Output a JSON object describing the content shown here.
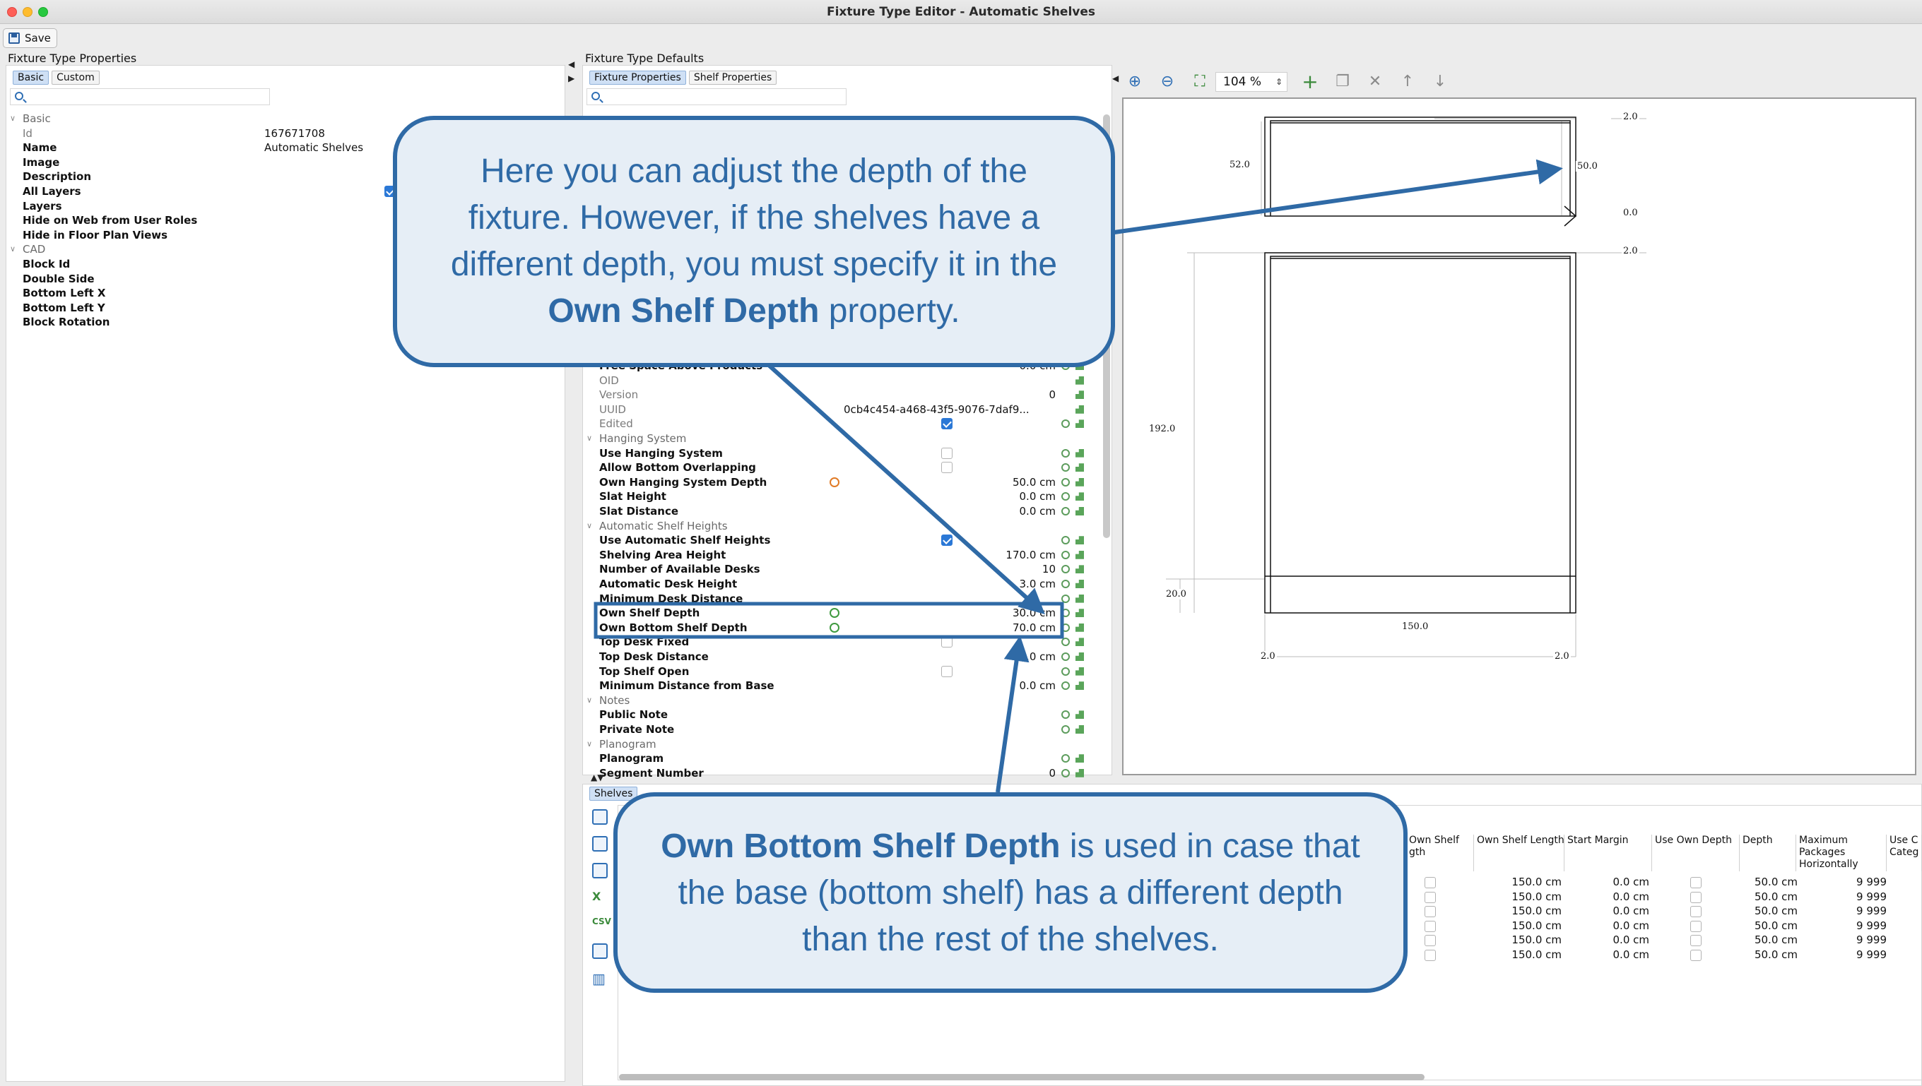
{
  "window": {
    "title": "Fixture Type Editor - Automatic Shelves"
  },
  "toolbar": {
    "save_label": "Save"
  },
  "left": {
    "section_title": "Fixture Type Properties",
    "tabs": [
      "Basic",
      "Custom"
    ],
    "groups": [
      {
        "name": "Basic",
        "rows": [
          {
            "key": "Id",
            "value": "167671708",
            "dim": true
          },
          {
            "key": "Name",
            "value": "Automatic Shelves"
          },
          {
            "key": "Image",
            "value": ""
          },
          {
            "key": "Description",
            "value": ""
          },
          {
            "key": "All Layers",
            "value": "",
            "checked": true
          },
          {
            "key": "Layers",
            "value": ""
          },
          {
            "key": "Hide on Web from User Roles",
            "value": ""
          },
          {
            "key": "Hide in Floor Plan Views",
            "value": ""
          }
        ]
      },
      {
        "name": "CAD",
        "rows": [
          {
            "key": "Block Id",
            "value": ""
          },
          {
            "key": "Double Side",
            "value": ""
          },
          {
            "key": "Bottom Left X",
            "value": ""
          },
          {
            "key": "Bottom Left Y",
            "value": ""
          },
          {
            "key": "Block Rotation",
            "value": ""
          }
        ]
      }
    ]
  },
  "middle": {
    "section_title": "Fixture Type Defaults",
    "tabs": [
      "Fixture Properties",
      "Shelf Properties"
    ],
    "rows": [
      {
        "key": "Free Space Above Products",
        "value": "0.0 cm",
        "partial": true
      },
      {
        "key": "OID",
        "value": "",
        "dim": true
      },
      {
        "key": "Version",
        "value": "0",
        "dim": true
      },
      {
        "key": "UUID",
        "value": "0cb4c454-a468-43f5-9076-7daf9...",
        "dim": true
      },
      {
        "key": "Edited",
        "value": "",
        "dim": true,
        "checked": true
      },
      {
        "key": "Hanging System",
        "group": true
      },
      {
        "key": "Use Hanging System",
        "value": "",
        "checkbox": true
      },
      {
        "key": "Allow Bottom Overlapping",
        "value": "",
        "checkbox": true
      },
      {
        "key": "Own Hanging System Depth",
        "value": "50.0 cm",
        "orange": true
      },
      {
        "key": "Slat Height",
        "value": "0.0 cm"
      },
      {
        "key": "Slat Distance",
        "value": "0.0 cm"
      },
      {
        "key": "Automatic Shelf Heights",
        "group": true
      },
      {
        "key": "Use Automatic Shelf Heights",
        "value": "",
        "checked": true
      },
      {
        "key": "Shelving Area Height",
        "value": "170.0 cm"
      },
      {
        "key": "Number of Available Desks",
        "value": "10"
      },
      {
        "key": "Automatic Desk Height",
        "value": "3.0 cm"
      },
      {
        "key": "Minimum Desk Distance",
        "value": ""
      },
      {
        "key": "Own Shelf Depth",
        "value": "30.0 cm",
        "ring": true
      },
      {
        "key": "Own Bottom Shelf Depth",
        "value": "70.0 cm",
        "ring": true
      },
      {
        "key": "Top Desk Fixed",
        "value": "",
        "checkbox": true
      },
      {
        "key": "Top Desk Distance",
        "value": "0.0 cm"
      },
      {
        "key": "Top Shelf Open",
        "value": "",
        "checkbox": true
      },
      {
        "key": "Minimum Distance from Base",
        "value": "0.0 cm"
      },
      {
        "key": "Notes",
        "group": true
      },
      {
        "key": "Public Note",
        "value": ""
      },
      {
        "key": "Private Note",
        "value": ""
      },
      {
        "key": "Planogram",
        "group": true
      },
      {
        "key": "Planogram",
        "value": ""
      },
      {
        "key": "Segment Number",
        "value": "0"
      }
    ]
  },
  "viewer": {
    "zoom": "104 %",
    "dims": {
      "d2a": "2.0",
      "d52": "52.0",
      "d50": "50.0",
      "d0": "0.0",
      "d2b": "2.0",
      "d192": "192.0",
      "d20": "20.0",
      "d150": "150.0",
      "d2c": "2.0",
      "d2d": "2.0"
    }
  },
  "bottom": {
    "tabs": [
      "Shelves"
    ],
    "headers": [
      "Own Shelf\ngth",
      "Own Shelf Length",
      "Start Margin",
      "Use Own Depth",
      "Depth",
      "Maximum\nPackages\nHorizontally",
      "Use C\nCateg"
    ],
    "rows": [
      [
        "150.0 cm",
        "0.0 cm",
        "50.0 cm",
        "9 999"
      ],
      [
        "150.0 cm",
        "0.0 cm",
        "50.0 cm",
        "9 999"
      ],
      [
        "150.0 cm",
        "0.0 cm",
        "50.0 cm",
        "9 999"
      ],
      [
        "150.0 cm",
        "0.0 cm",
        "50.0 cm",
        "9 999"
      ],
      [
        "150.0 cm",
        "0.0 cm",
        "50.0 cm",
        "9 999"
      ],
      [
        "150.0 cm",
        "0.0 cm",
        "50.0 cm",
        "9 999"
      ]
    ]
  },
  "callouts": {
    "top_pre": "Here you can adjust the depth of the fixture. However, if the shelves have a different depth, you must specify it in the ",
    "top_bold": "Own Shelf Depth",
    "top_post": " property.",
    "bottom_bold": "Own Bottom Shelf Depth",
    "bottom_post": " is used in case that the base (bottom shelf) has a different depth than the rest of the shelves."
  },
  "colors": {
    "accent": "#2f6aa6",
    "callout_bg": "#e6eef6"
  }
}
